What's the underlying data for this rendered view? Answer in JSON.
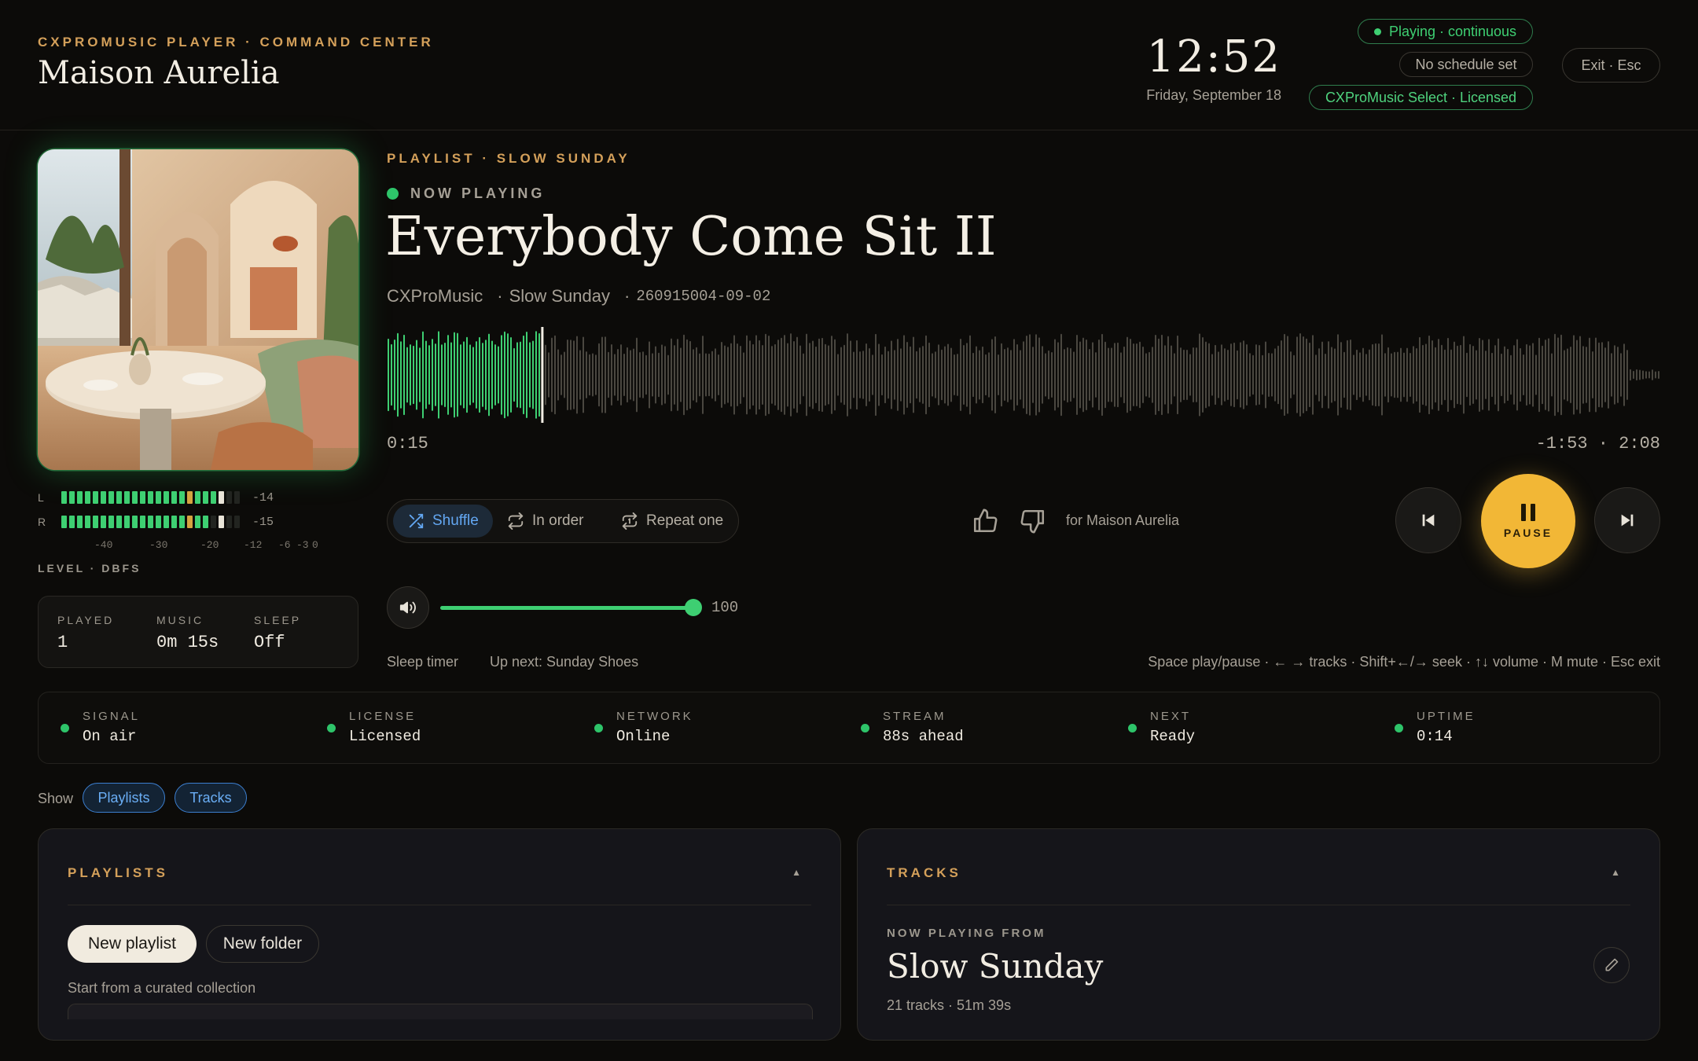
{
  "header": {
    "eyebrow": "CXPROMUSIC PLAYER · COMMAND CENTER",
    "venue": "Maison Aurelia",
    "clock": "12:52",
    "date": "Friday, September 18",
    "status_playing": "Playing · continuous",
    "status_schedule": "No schedule set",
    "status_license": "CXProMusic Select · Licensed",
    "exit_label": "Exit · Esc"
  },
  "meters": {
    "left": {
      "channel": "L",
      "value": "-14",
      "level": 0.88
    },
    "right": {
      "channel": "R",
      "value": "-15",
      "level": 0.83
    },
    "scale": [
      "-40",
      "-30",
      "-20",
      "-12",
      "-6",
      "-3",
      "0"
    ],
    "label": "LEVEL · DBFS"
  },
  "stats": {
    "played_label": "PLAYED",
    "played_value": "1",
    "music_label": "MUSIC",
    "music_value": "0m 15s",
    "sleep_label": "SLEEP",
    "sleep_value": "Off"
  },
  "player": {
    "playlist_eyebrow": "PLAYLIST · SLOW SUNDAY",
    "now_playing_label": "NOW PLAYING",
    "title": "Everybody Come Sit II",
    "artist": "CXProMusic",
    "album": "Slow Sunday",
    "track_id": "260915004-09-02",
    "elapsed": "0:15",
    "remaining": "-1:53 · 2:08",
    "progress": 0.12,
    "modes": {
      "shuffle": "Shuffle",
      "in_order": "In order",
      "repeat_one": "Repeat one"
    },
    "for_venue": "for Maison Aurelia",
    "pause_label": "PAUSE",
    "volume": 100,
    "volume_label": "100",
    "sleep_timer": "Sleep timer",
    "up_next": "Up next: Sunday Shoes",
    "shortcuts": "Space play/pause · ← → tracks · Shift+←/→ seek · ↑↓ volume · M mute · Esc exit"
  },
  "status_strip": [
    {
      "label": "SIGNAL",
      "value": "On air"
    },
    {
      "label": "LICENSE",
      "value": "Licensed"
    },
    {
      "label": "NETWORK",
      "value": "Online"
    },
    {
      "label": "STREAM",
      "value": "88s ahead"
    },
    {
      "label": "NEXT",
      "value": "Ready"
    },
    {
      "label": "UPTIME",
      "value": "0:14"
    }
  ],
  "show": {
    "label": "Show",
    "playlists": "Playlists",
    "tracks": "Tracks"
  },
  "playlists_panel": {
    "title": "PLAYLISTS",
    "new_playlist": "New playlist",
    "new_folder": "New folder",
    "curated_label": "Start from a curated collection"
  },
  "tracks_panel": {
    "title": "TRACKS",
    "np_from": "NOW PLAYING FROM",
    "playlist": "Slow Sunday",
    "info": "21 tracks · 51m 39s"
  },
  "colors": {
    "accent_green": "#3ecf72",
    "accent_gold": "#f2b736",
    "accent_blue": "#63a7f2",
    "eyebrow": "#d4a05a"
  }
}
